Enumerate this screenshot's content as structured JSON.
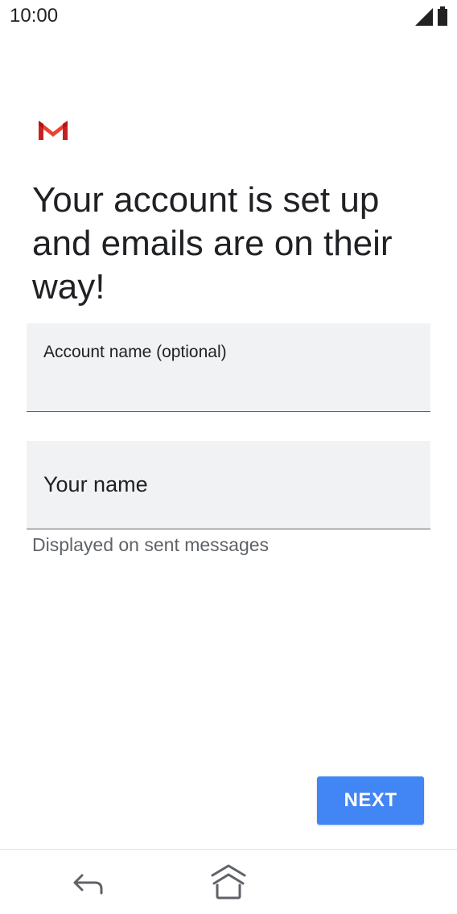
{
  "status_bar": {
    "time": "10:00",
    "icons": [
      "signal-icon",
      "battery-icon"
    ]
  },
  "app": {
    "logo": "gmail-logo",
    "brand_colors": [
      "#d93025",
      "#ea4335",
      "#c5221f"
    ]
  },
  "setup": {
    "heading": "Your account is set up and emails are on their way!",
    "account_name_field": {
      "label": "Account name (optional)",
      "value": ""
    },
    "your_name_field": {
      "placeholder": "Your name",
      "value": "",
      "helper": "Displayed on sent messages"
    },
    "next_label": "NEXT"
  },
  "navigation": {
    "icons": [
      "back-icon",
      "home-icon"
    ]
  },
  "colors": {
    "accent": "#4285f4",
    "field_bg": "#f1f2f4",
    "helper_text": "#5f6368"
  }
}
